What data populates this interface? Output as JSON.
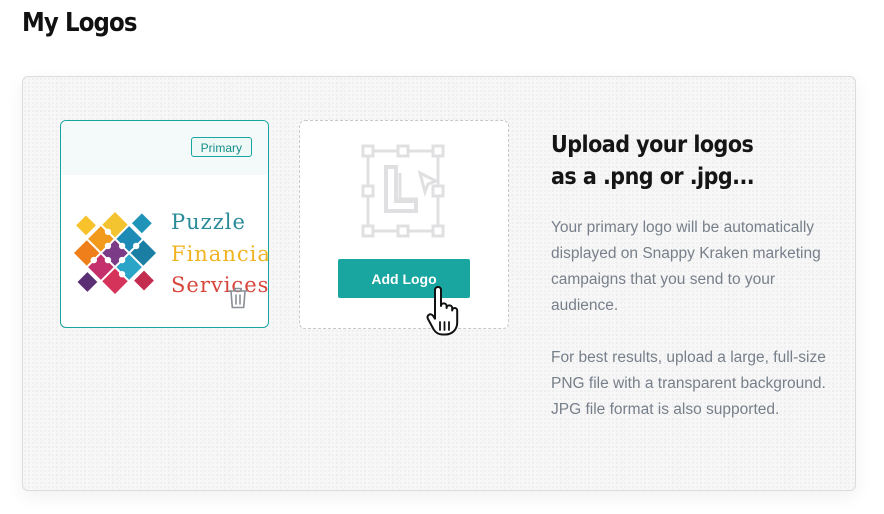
{
  "page": {
    "title": "My Logos"
  },
  "logo_card": {
    "badge": "Primary",
    "logo_text": {
      "line1": "Puzzle",
      "line2": "Financial",
      "line3": "Services"
    }
  },
  "upload": {
    "button_label": "Add Logo"
  },
  "info": {
    "heading": "Upload your logos as a .png or .jpg...",
    "paragraph1": "Your primary logo will be automatically displayed on Snappy Kraken marketing campaigns that you send to your audience.",
    "paragraph2": "For best results, upload a large, full-size PNG file with a transparent background. JPG file format is also supported."
  },
  "colors": {
    "accent": "#19a5a0",
    "text_muted": "#777f8a",
    "heading": "#151515"
  },
  "icons": [
    "trash-icon",
    "logo-placeholder-icon",
    "hand-pointer-icon",
    "puzzle-logo-icon"
  ]
}
